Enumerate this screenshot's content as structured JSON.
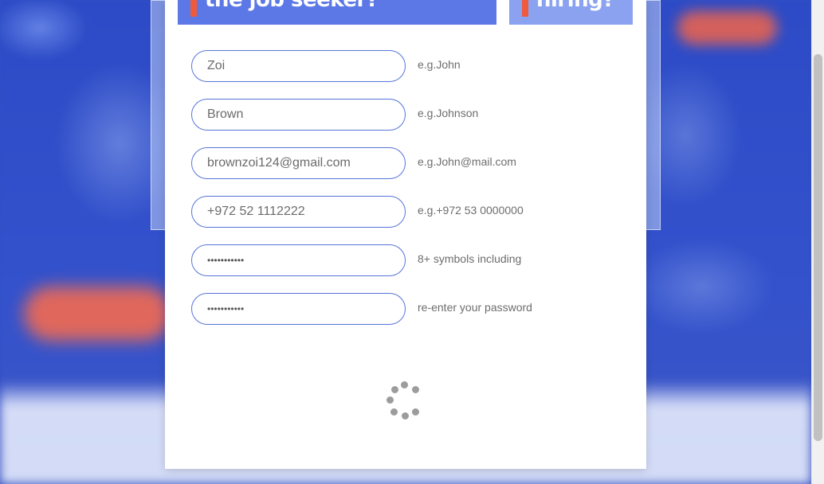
{
  "tabs": {
    "seeker_label": "the job seeker?",
    "hiring_label": "hiring?"
  },
  "form": {
    "fields": [
      {
        "value": "Zoi",
        "hint": "e.g.John",
        "type": "text"
      },
      {
        "value": "Brown",
        "hint": "e.g.Johnson",
        "type": "text"
      },
      {
        "value": "brownzoi124@gmail.com",
        "hint": "e.g.John@mail.com",
        "type": "email"
      },
      {
        "value": "+972 52 1112222",
        "hint": "e.g.+972 53 0000000",
        "type": "tel"
      },
      {
        "value": "•••••••••••",
        "hint": "8+ symbols including",
        "type": "password"
      },
      {
        "value": "•••••••••••",
        "hint": "re-enter your password",
        "type": "password"
      }
    ]
  },
  "loading": {
    "icon": "loading-spinner-icon"
  },
  "colors": {
    "accent": "#5574d9",
    "tab_active": "#5b78e6",
    "tab_inactive": "#8aa2f0",
    "marker": "#f05a3c",
    "background": "#2f4fc4"
  }
}
